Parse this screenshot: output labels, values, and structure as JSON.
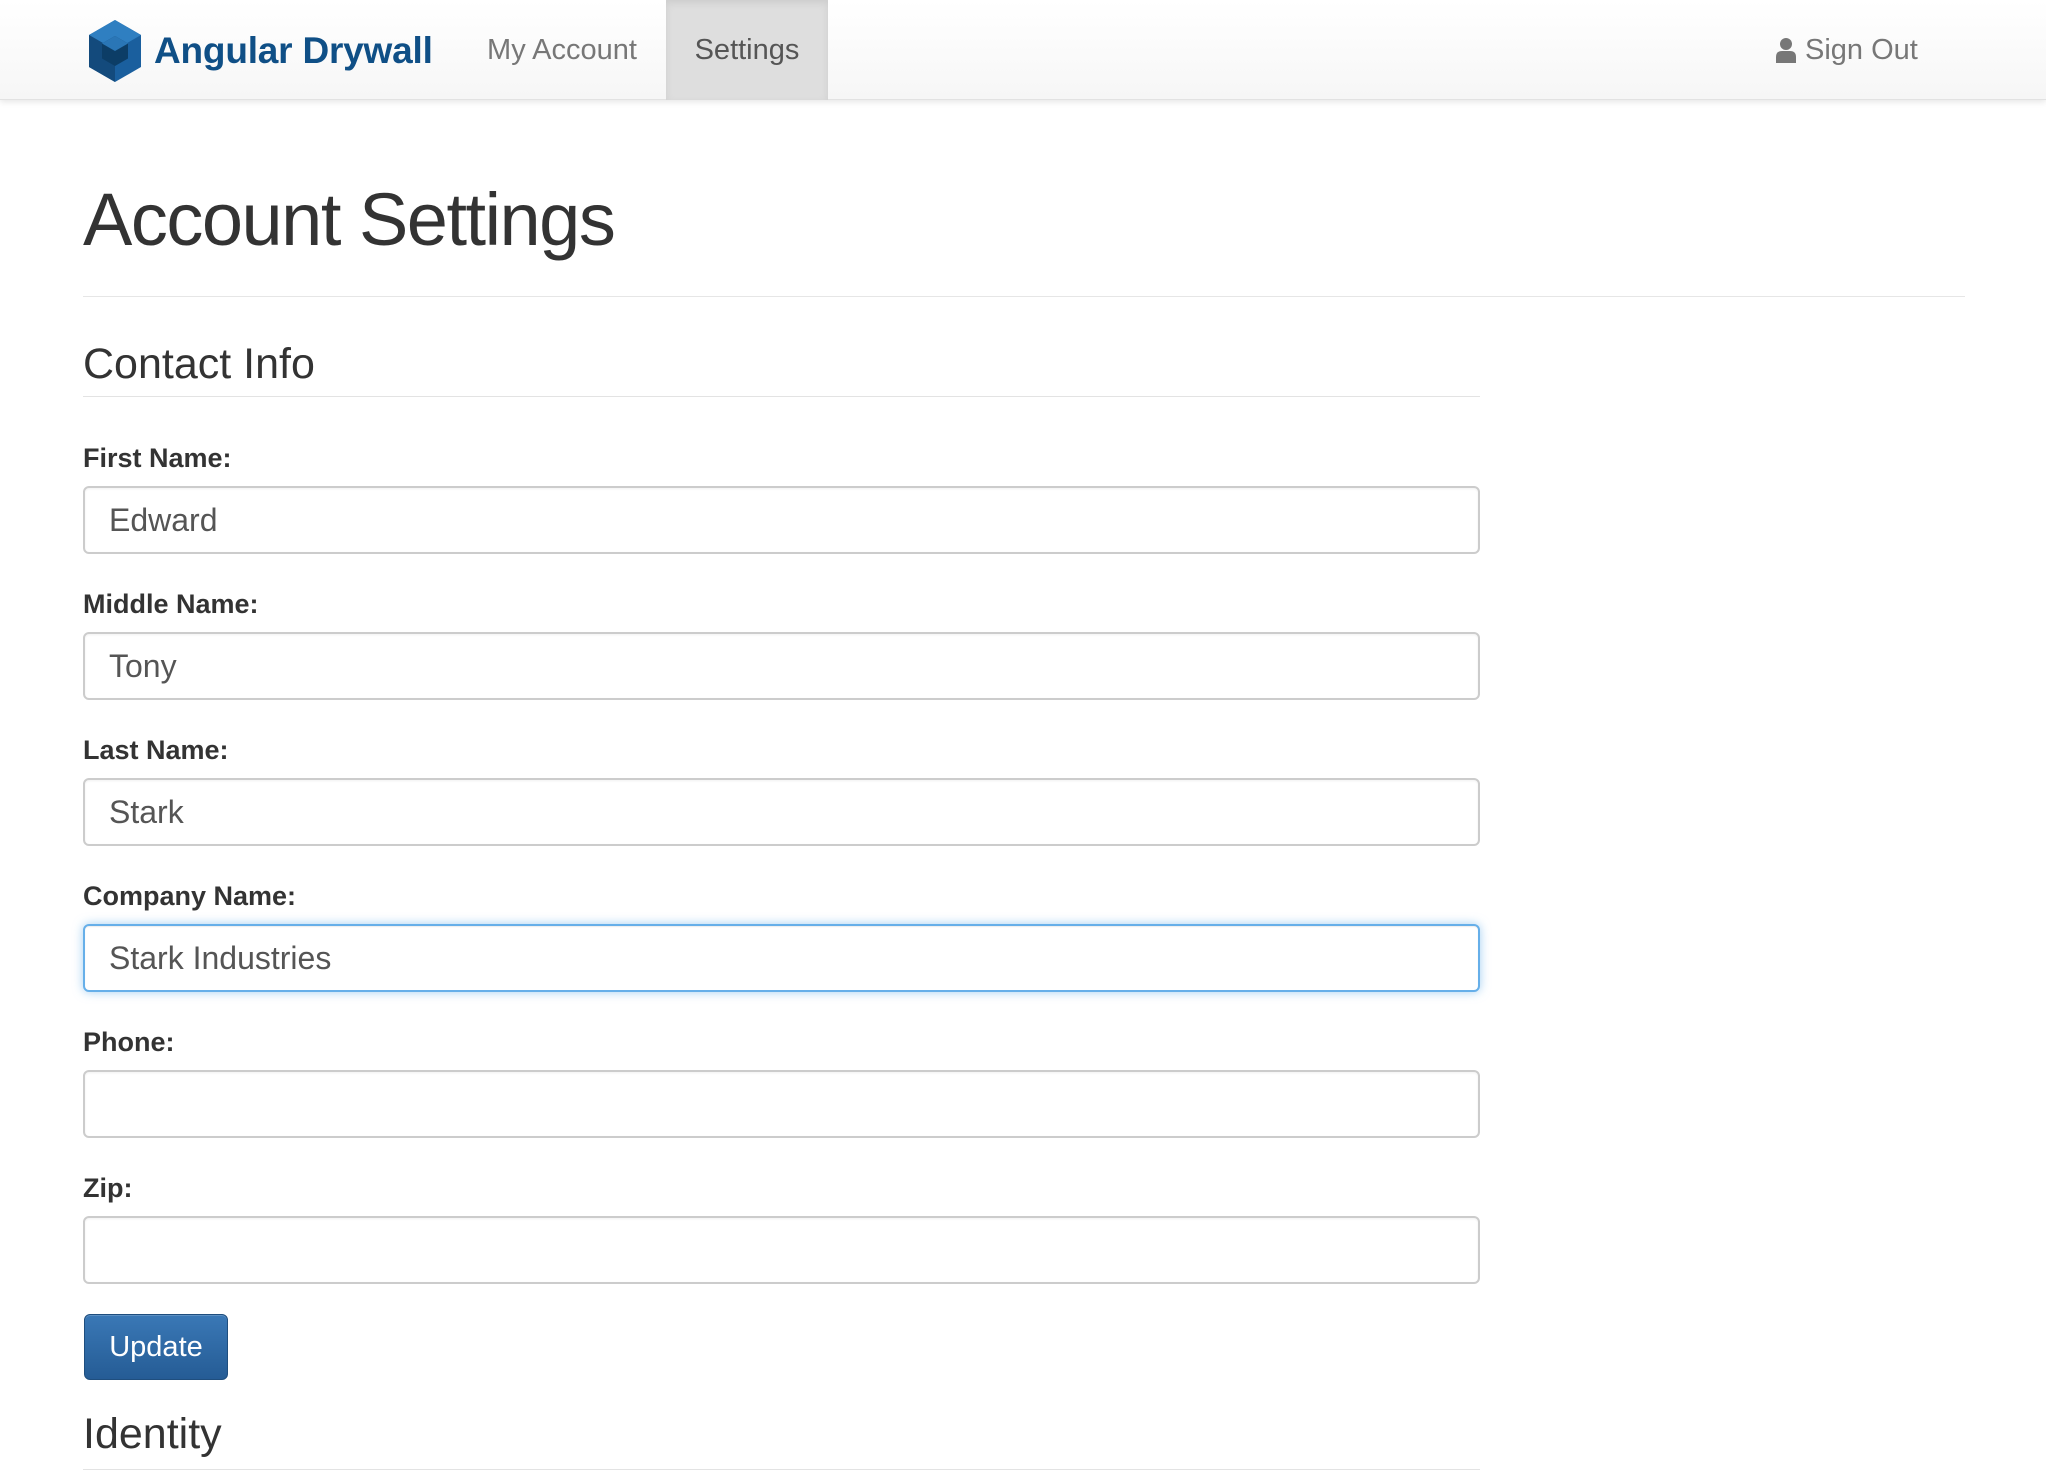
{
  "brand": {
    "name": "Angular Drywall",
    "logo_icon": "blue-hexagon-cube-logo",
    "color": "#0f4f86"
  },
  "nav": {
    "my_account": "My Account",
    "settings": "Settings",
    "sign_out": "Sign Out",
    "active_item": "Settings"
  },
  "page": {
    "title": "Account Settings"
  },
  "contact_info": {
    "heading": "Contact Info",
    "fields": {
      "first_name": {
        "label": "First Name:",
        "value": "Edward"
      },
      "middle_name": {
        "label": "Middle Name:",
        "value": "Tony"
      },
      "last_name": {
        "label": "Last Name:",
        "value": "Stark"
      },
      "company_name": {
        "label": "Company Name:",
        "value": "Stark Industries",
        "focused": true
      },
      "phone": {
        "label": "Phone:",
        "value": ""
      },
      "zip": {
        "label": "Zip:",
        "value": ""
      }
    },
    "update_label": "Update"
  },
  "identity": {
    "heading": "Identity"
  },
  "colors": {
    "primary_button": "#2d6ca9",
    "focus_ring": "#66afe9",
    "active_nav_bg": "#dedede"
  }
}
